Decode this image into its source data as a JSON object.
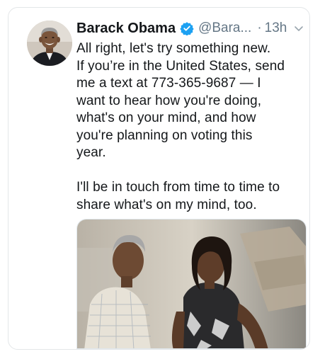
{
  "tweet": {
    "author_name": "Barack Obama",
    "handle": "@Bara...",
    "separator": "·",
    "time_ago": "13h",
    "text": "All right, let's try something new.\nIf you’re in the United States, send\nme a text at 773-365-9687 — I\nwant to hear how you're doing,\nwhat's on your mind, and how\nyou're planning on voting this\nyear.\n\nI'll be in touch from time to time to\nshare what's on my mind, too.",
    "verified": true
  },
  "icons": {
    "verified": "verified-badge-icon",
    "more": "chevron-down-icon"
  },
  "colors": {
    "text": "#14171a",
    "secondary": "#657786",
    "accent": "#1da1f2",
    "border": "#e3e6e8"
  }
}
